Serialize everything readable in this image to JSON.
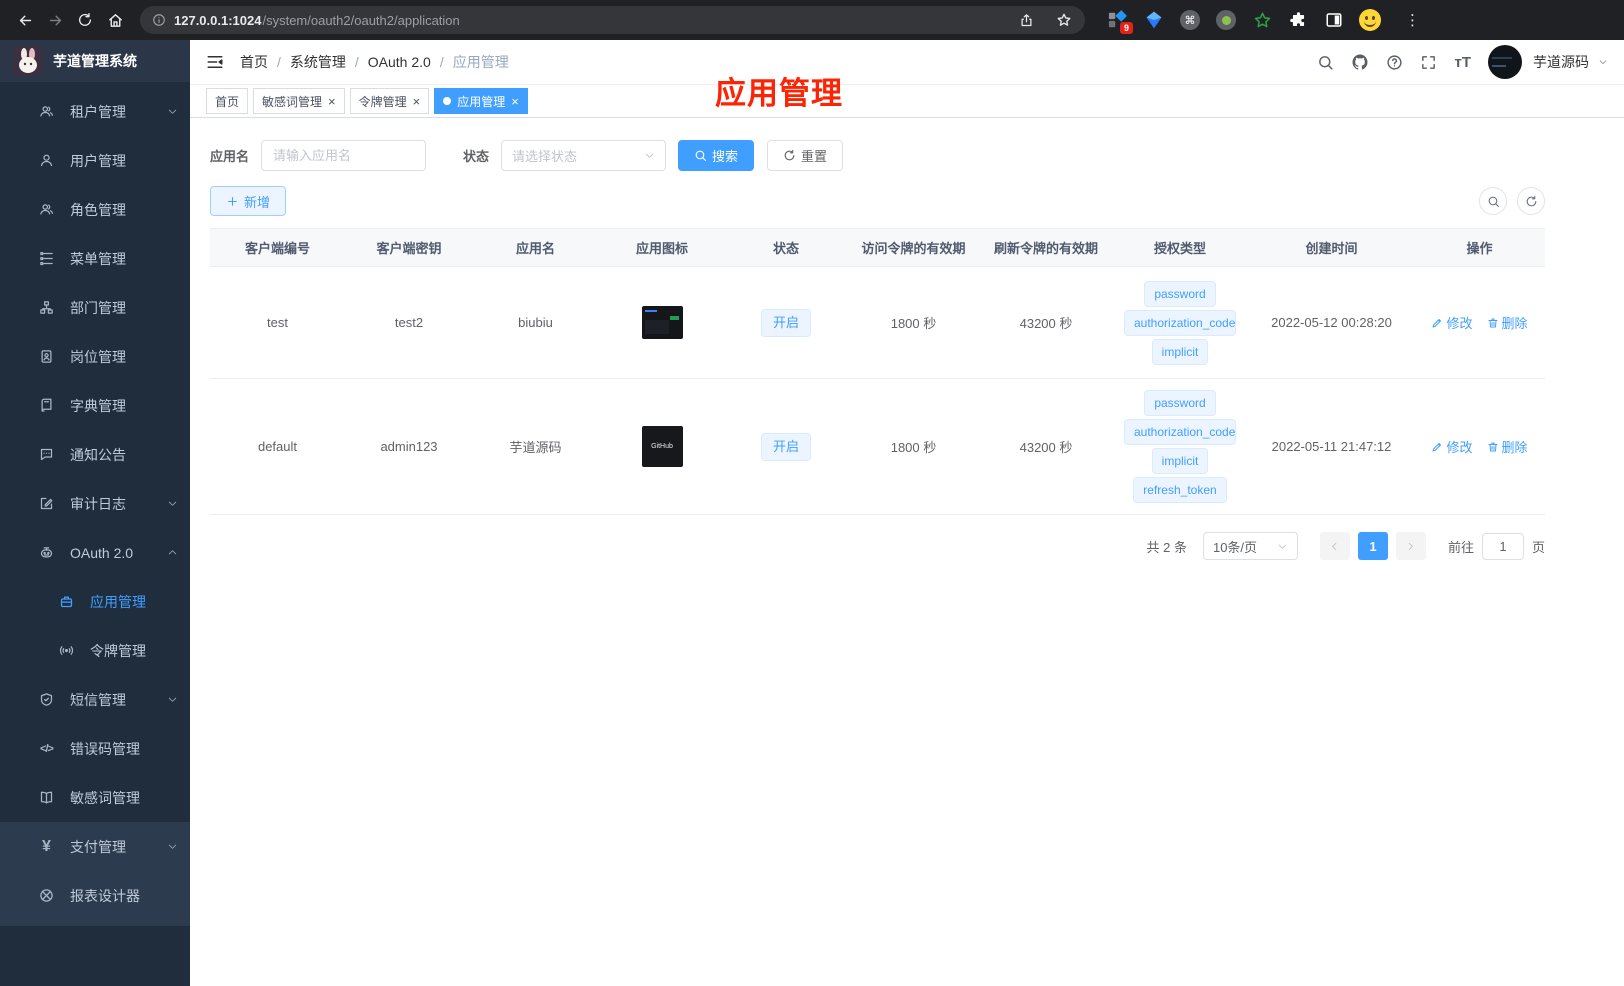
{
  "browser": {
    "host": "127.0.0.1:1024",
    "path": "/system/oauth2/oauth2/application",
    "ext_badge": "9"
  },
  "sidebar": {
    "title": "芋道管理系统",
    "items": [
      {
        "label": "租户管理",
        "icon": "users-icon",
        "arrow": "down"
      },
      {
        "label": "用户管理",
        "icon": "user-icon"
      },
      {
        "label": "角色管理",
        "icon": "users-icon"
      },
      {
        "label": "菜单管理",
        "icon": "menu-tree-icon"
      },
      {
        "label": "部门管理",
        "icon": "org-chart-icon"
      },
      {
        "label": "岗位管理",
        "icon": "id-badge-icon"
      },
      {
        "label": "字典管理",
        "icon": "dictionary-book-icon"
      },
      {
        "label": "通知公告",
        "icon": "message-icon"
      },
      {
        "label": "审计日志",
        "icon": "audit-log-icon",
        "arrow": "down"
      },
      {
        "label": "OAuth 2.0",
        "icon": "robot-icon",
        "arrow": "up"
      },
      {
        "label": "应用管理",
        "icon": "briefcase-icon",
        "active": true,
        "sub": true
      },
      {
        "label": "令牌管理",
        "icon": "broadcast-icon",
        "sub": true
      },
      {
        "label": "短信管理",
        "icon": "shield-check-icon",
        "arrow": "down"
      },
      {
        "label": "错误码管理",
        "icon": "code-icon"
      },
      {
        "label": "敏感词管理",
        "icon": "open-book-icon"
      },
      {
        "label": "支付管理",
        "icon": "yen-icon",
        "arrow": "down"
      },
      {
        "label": "报表设计器",
        "icon": "compass-icon"
      }
    ]
  },
  "header": {
    "breadcrumb": [
      "首页",
      "系统管理",
      "OAuth 2.0",
      "应用管理"
    ],
    "separator": "/",
    "username": "芋道源码",
    "icons": [
      "search-icon",
      "github-icon",
      "help-icon",
      "fullscreen-icon",
      "font-size-icon"
    ]
  },
  "tabs": [
    {
      "label": "首页",
      "closable": false,
      "active": false
    },
    {
      "label": "敏感词管理",
      "closable": true,
      "active": false
    },
    {
      "label": "令牌管理",
      "closable": true,
      "active": false
    },
    {
      "label": "应用管理",
      "closable": true,
      "active": true
    }
  ],
  "annotation": {
    "title": "应用管理"
  },
  "toolbar": {
    "name_label": "应用名",
    "name_placeholder": "请输入应用名",
    "status_label": "状态",
    "status_placeholder": "请选择状态",
    "search_label": "搜索",
    "reset_label": "重置",
    "add_label": "新增"
  },
  "table": {
    "columns": [
      "客户端编号",
      "客户端密钥",
      "应用名",
      "应用图标",
      "状态",
      "访问令牌的有效期",
      "刷新令牌的有效期",
      "授权类型",
      "创建时间",
      "操作"
    ],
    "edit_label": "修改",
    "delete_label": "删除",
    "rows": [
      {
        "client_id": "test",
        "secret": "test2",
        "name": "biubiu",
        "status": "开启",
        "access_ttl": "1800 秒",
        "refresh_ttl": "43200 秒",
        "grants": [
          "password",
          "authorization_code",
          "implicit"
        ],
        "created": "2022-05-12 00:28:20"
      },
      {
        "client_id": "default",
        "secret": "admin123",
        "name": "芋道源码",
        "icon_text": "GitHub",
        "status": "开启",
        "access_ttl": "1800 秒",
        "refresh_ttl": "43200 秒",
        "grants": [
          "password",
          "authorization_code",
          "implicit",
          "refresh_token"
        ],
        "created": "2022-05-11 21:47:12"
      }
    ]
  },
  "pagination": {
    "total": "共 2 条",
    "page_size": "10条/页",
    "page": "1",
    "goto_label": "前往",
    "unit_label": "页"
  }
}
